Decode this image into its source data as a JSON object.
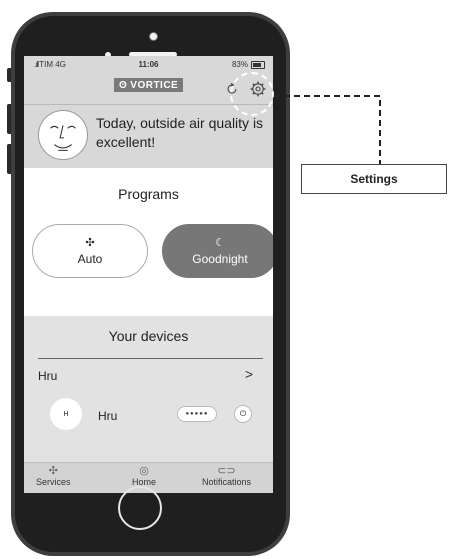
{
  "status_bar": {
    "carrier": "TIM 4G",
    "time": "11:06",
    "battery": "83%"
  },
  "app": {
    "logo": "VORTICE",
    "headline": "Today, outside air quality is excellent!"
  },
  "programs": {
    "title": "Programs",
    "items": [
      {
        "label": "Auto",
        "icon": "fan-icon",
        "active": false
      },
      {
        "label": "Goodnight",
        "icon": "moon-icon",
        "active": true
      }
    ]
  },
  "devices": {
    "title": "Your devices",
    "group": "Hru",
    "device": {
      "avatar": "H",
      "name": "Hru",
      "speed": "●●●●●"
    }
  },
  "tabs": [
    {
      "label": "Services",
      "icon": "fan-icon"
    },
    {
      "label": "Home",
      "icon": "home-icon"
    },
    {
      "label": "Notifications",
      "icon": "bell-icon"
    }
  ],
  "callout": {
    "label": "Settings"
  }
}
